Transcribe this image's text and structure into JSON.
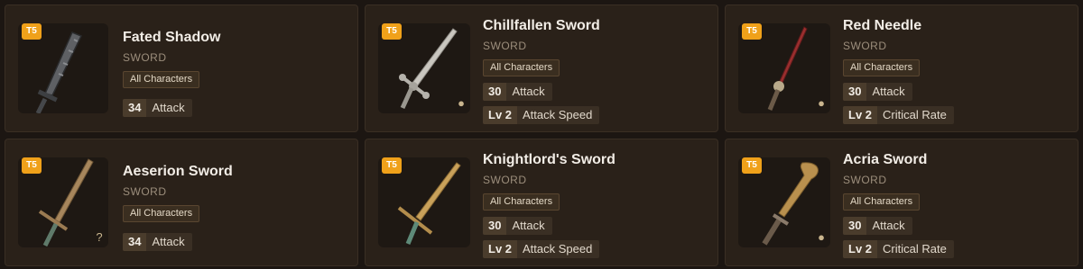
{
  "cards": [
    {
      "tier": "T5",
      "name": "Fated Shadow",
      "type": "SWORD",
      "characters": "All Characters",
      "stat1_value": "34",
      "stat1_label": "Attack",
      "stat2_value": "",
      "stat2_label": "",
      "corner_icon": "",
      "blade_color": "#6b6d70"
    },
    {
      "tier": "T5",
      "name": "Chillfallen Sword",
      "type": "SWORD",
      "characters": "All Characters",
      "stat1_value": "30",
      "stat1_label": "Attack",
      "stat2_value": "Lv 2",
      "stat2_label": "Attack Speed",
      "corner_icon": "location-pin-icon",
      "blade_color": "#b7b4ad"
    },
    {
      "tier": "T5",
      "name": "Red Needle",
      "type": "SWORD",
      "characters": "All Characters",
      "stat1_value": "30",
      "stat1_label": "Attack",
      "stat2_value": "Lv 2",
      "stat2_label": "Critical Rate",
      "corner_icon": "location-pin-icon",
      "blade_color": "#8a2a2a"
    },
    {
      "tier": "T5",
      "name": "Aeserion Sword",
      "type": "SWORD",
      "characters": "All Characters",
      "stat1_value": "34",
      "stat1_label": "Attack",
      "stat2_value": "",
      "stat2_label": "",
      "corner_icon": "question-icon",
      "corner_text": "?",
      "blade_color": "#a8865a"
    },
    {
      "tier": "T5",
      "name": "Knightlord's Sword",
      "type": "SWORD",
      "characters": "All Characters",
      "stat1_value": "30",
      "stat1_label": "Attack",
      "stat2_value": "Lv 2",
      "stat2_label": "Attack Speed",
      "corner_icon": "",
      "blade_color": "#c49a4c"
    },
    {
      "tier": "T5",
      "name": "Acria Sword",
      "type": "SWORD",
      "characters": "All Characters",
      "stat1_value": "30",
      "stat1_label": "Attack",
      "stat2_value": "Lv 2",
      "stat2_label": "Critical Rate",
      "corner_icon": "location-pin-icon",
      "blade_color": "#b9904e"
    }
  ],
  "colors": {
    "tier_badge": "#f0a11a",
    "card_bg": "#2a2119",
    "page_bg": "#1c1612"
  }
}
